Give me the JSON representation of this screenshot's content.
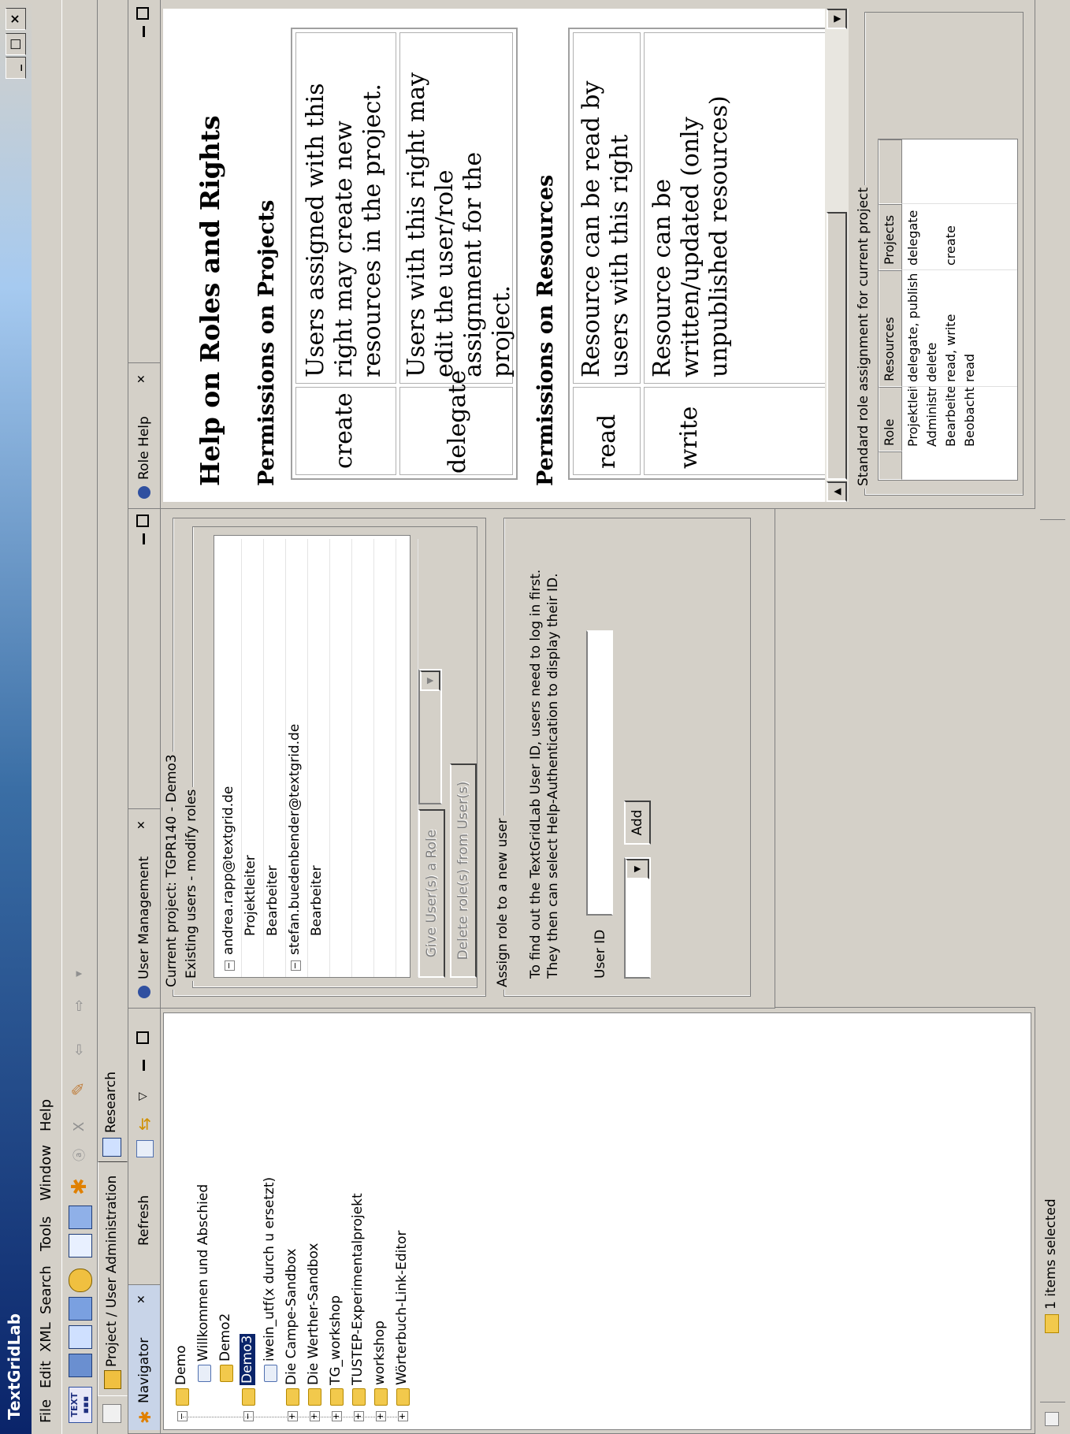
{
  "window": {
    "title": "TextGridLab"
  },
  "menu": [
    "File",
    "Edit",
    "XML",
    "Search",
    "Tools",
    "Window",
    "Help"
  ],
  "perspectives": {
    "active": "Project / User Administration",
    "other": "Research"
  },
  "navigator": {
    "tab": "Navigator",
    "refresh": "Refresh",
    "items": [
      "Demo",
      "Willkommen und Abschied",
      "Demo2",
      "Demo3",
      "iwein_utf(x durch u ersetzt)",
      "Die Campe-Sandbox",
      "Die Werther-Sandbox",
      "TG_workshop",
      "TUSTEP-Experimentalprojekt",
      "workshop",
      "Wörterbuch-Link-Editor"
    ]
  },
  "user_management": {
    "tab": "User Management",
    "current_project": "Current project: TGPR140 - Demo3",
    "existing_users_legend": "Existing users - modify roles",
    "users": [
      {
        "name": "andrea.rapp@textgrid.de",
        "roles": [
          "Projektleiter",
          "Bearbeiter"
        ]
      },
      {
        "name": "stefan.buedenbender@textgrid.de",
        "roles": [
          "Bearbeiter"
        ]
      }
    ],
    "give_role_button": "Give User(s) a Role",
    "delete_role_button": "Delete role(s) from User(s)",
    "assign_legend": "Assign role to a new user",
    "info_line1": "To find out the TextGridLab User ID, users need to log in first.",
    "info_line2": "They then can select Help-Authentication to display their ID.",
    "user_id_label": "User ID",
    "add_button": "Add"
  },
  "role_help": {
    "tab": "Role Help",
    "title": "Help on Roles and Rights",
    "projects_heading": "Permissions on Projects",
    "project_perms": [
      {
        "name": "create",
        "lines": [
          "Users assigned with this",
          "right may create new",
          "resources in the project."
        ]
      },
      {
        "name": "delegate",
        "lines": [
          "Users with this right may",
          "edit the user/role",
          "assignment for the",
          "project."
        ]
      }
    ],
    "resources_heading": "Permissions on Resources",
    "resource_perms": [
      {
        "name": "read",
        "lines": [
          "Resource can be read by",
          "users with this right"
        ]
      },
      {
        "name": "write",
        "lines": [
          "Resource can be",
          "written/updated (only",
          "unpublished resources)"
        ]
      }
    ],
    "std_legend": "Standard role assignment for current project",
    "std_headers": [
      "Role",
      "Resources",
      "Projects"
    ],
    "std_rows": [
      [
        "Projektleiter",
        "delegate, publish",
        "delegate"
      ],
      [
        "Administra…",
        "delete",
        ""
      ],
      [
        "Bearbeiter",
        "read, write",
        "create"
      ],
      [
        "Beobachter",
        "read",
        ""
      ]
    ]
  },
  "status": {
    "text": "1 items selected"
  }
}
